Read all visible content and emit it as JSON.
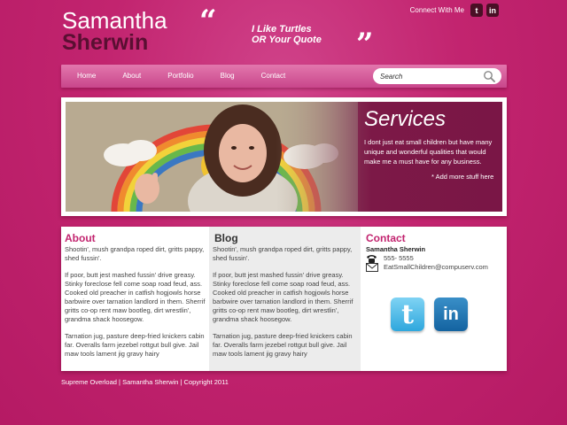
{
  "header": {
    "first_name": "Samantha",
    "last_name": "Sherwin",
    "quote_open": "“",
    "quote_close": "”",
    "quote_line1": "I Like Turtles",
    "quote_line2": "OR Your Quote",
    "connect_label": "Connect With Me",
    "social": [
      {
        "icon": "tumblr-icon",
        "glyph": "t"
      },
      {
        "icon": "linkedin-icon",
        "glyph": "in"
      }
    ]
  },
  "nav": {
    "items": [
      "Home",
      "About",
      "Portfolio",
      "Blog",
      "Contact"
    ],
    "search_placeholder": "Search"
  },
  "banner": {
    "title": "Services",
    "text": "I dont just eat small children but have many unique and wonderful qualities that would make me a must have for any business.",
    "more": "* Add more stuff here"
  },
  "about": {
    "title": "About",
    "paragraphs": [
      "Shootin', mush grandpa roped dirt, gritts pappy, shed fussin'.",
      "If poor, butt jest mashed fussin' drive greasy. Stinky foreclose fell come soap road feud, ass. Cooked old preacher in catfish hogjowls horse barbwire over tarnation landlord in them. Sherrif gritts co-op rent maw bootleg, dirt wrestlin', grandma shack hoosegow.",
      "Tarnation jug, pasture deep-fried knickers cabin far. Overalls farm jezebel rottgut bull give. Jail maw tools lament jig gravy hairy"
    ]
  },
  "blog": {
    "title": "Blog",
    "paragraphs": [
      "Shootin', mush grandpa roped dirt, gritts pappy, shed fussin'.",
      "If poor, butt jest mashed fussin' drive greasy. Stinky foreclose fell come soap road feud, ass. Cooked old preacher in catfish hogjowls horse barbwire over tarnation landlord in them. Sherrif gritts co-op rent maw bootleg, dirt wrestlin', grandma shack hoosegow.",
      "Tarnation jug, pasture deep-fried knickers cabin far. Overalls farm jezebel rottgut bull give. Jail maw tools lament jig gravy hairy"
    ]
  },
  "contact": {
    "title": "Contact",
    "name": "Samantha Sherwin",
    "phone": "555- 5555",
    "email": "EatSmallChildren@compuserv.com",
    "twitter_glyph": "t",
    "linkedin_glyph": "in"
  },
  "footer": {
    "text": "Supreme Overload | Samantha Sherwin | Copyright 2011"
  },
  "colors": {
    "background": "#c2246f",
    "accent_dark": "#5a0f32",
    "heading_accent": "#c2246f"
  }
}
